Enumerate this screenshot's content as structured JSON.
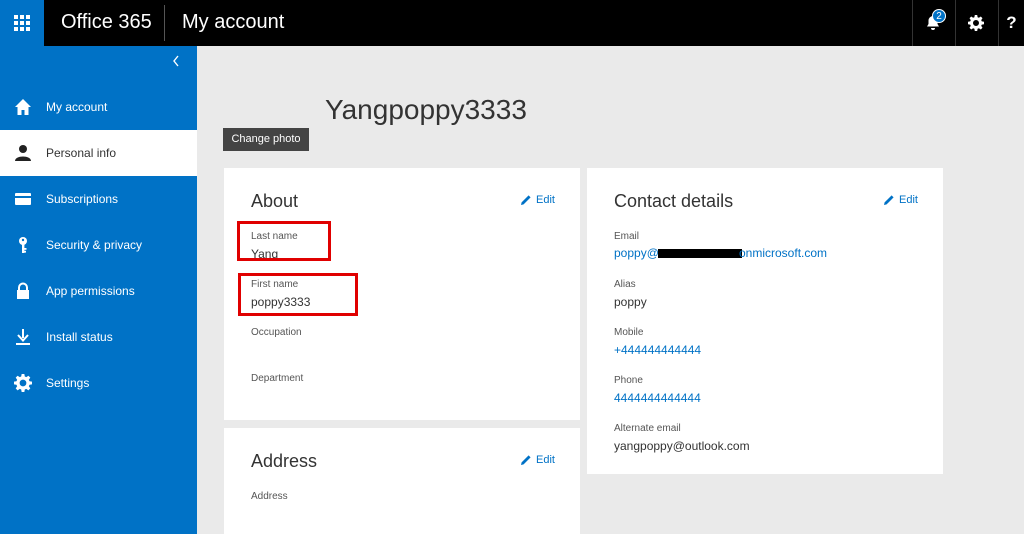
{
  "header": {
    "brand": "Office 365",
    "title": "My account",
    "notification_count": "2",
    "help_label": "?"
  },
  "sidebar": {
    "items": [
      {
        "label": "My account",
        "icon": "home-icon"
      },
      {
        "label": "Personal info",
        "icon": "person-icon",
        "active": true
      },
      {
        "label": "Subscriptions",
        "icon": "card-icon"
      },
      {
        "label": "Security & privacy",
        "icon": "key-icon"
      },
      {
        "label": "App permissions",
        "icon": "lock-icon"
      },
      {
        "label": "Install status",
        "icon": "download-icon"
      },
      {
        "label": "Settings",
        "icon": "gear-icon"
      }
    ]
  },
  "profile": {
    "name": "Yangpoppy3333",
    "change_photo": "Change photo"
  },
  "about": {
    "title": "About",
    "edit": "Edit",
    "last_name_label": "Last name",
    "last_name": "Yang",
    "first_name_label": "First name",
    "first_name": "poppy3333",
    "occupation_label": "Occupation",
    "department_label": "Department"
  },
  "address": {
    "title": "Address",
    "edit": "Edit",
    "address_label": "Address"
  },
  "contact": {
    "title": "Contact details",
    "edit": "Edit",
    "email_label": "Email",
    "email_prefix": "poppy@",
    "email_suffix": "onmicrosoft.com",
    "alias_label": "Alias",
    "alias": "poppy",
    "mobile_label": "Mobile",
    "mobile": "+444444444444",
    "phone_label": "Phone",
    "phone": "4444444444444",
    "alt_email_label": "Alternate email",
    "alt_email": "yangpoppy@outlook.com"
  },
  "colors": {
    "accent": "#0072c6",
    "highlight": "#e00000"
  }
}
